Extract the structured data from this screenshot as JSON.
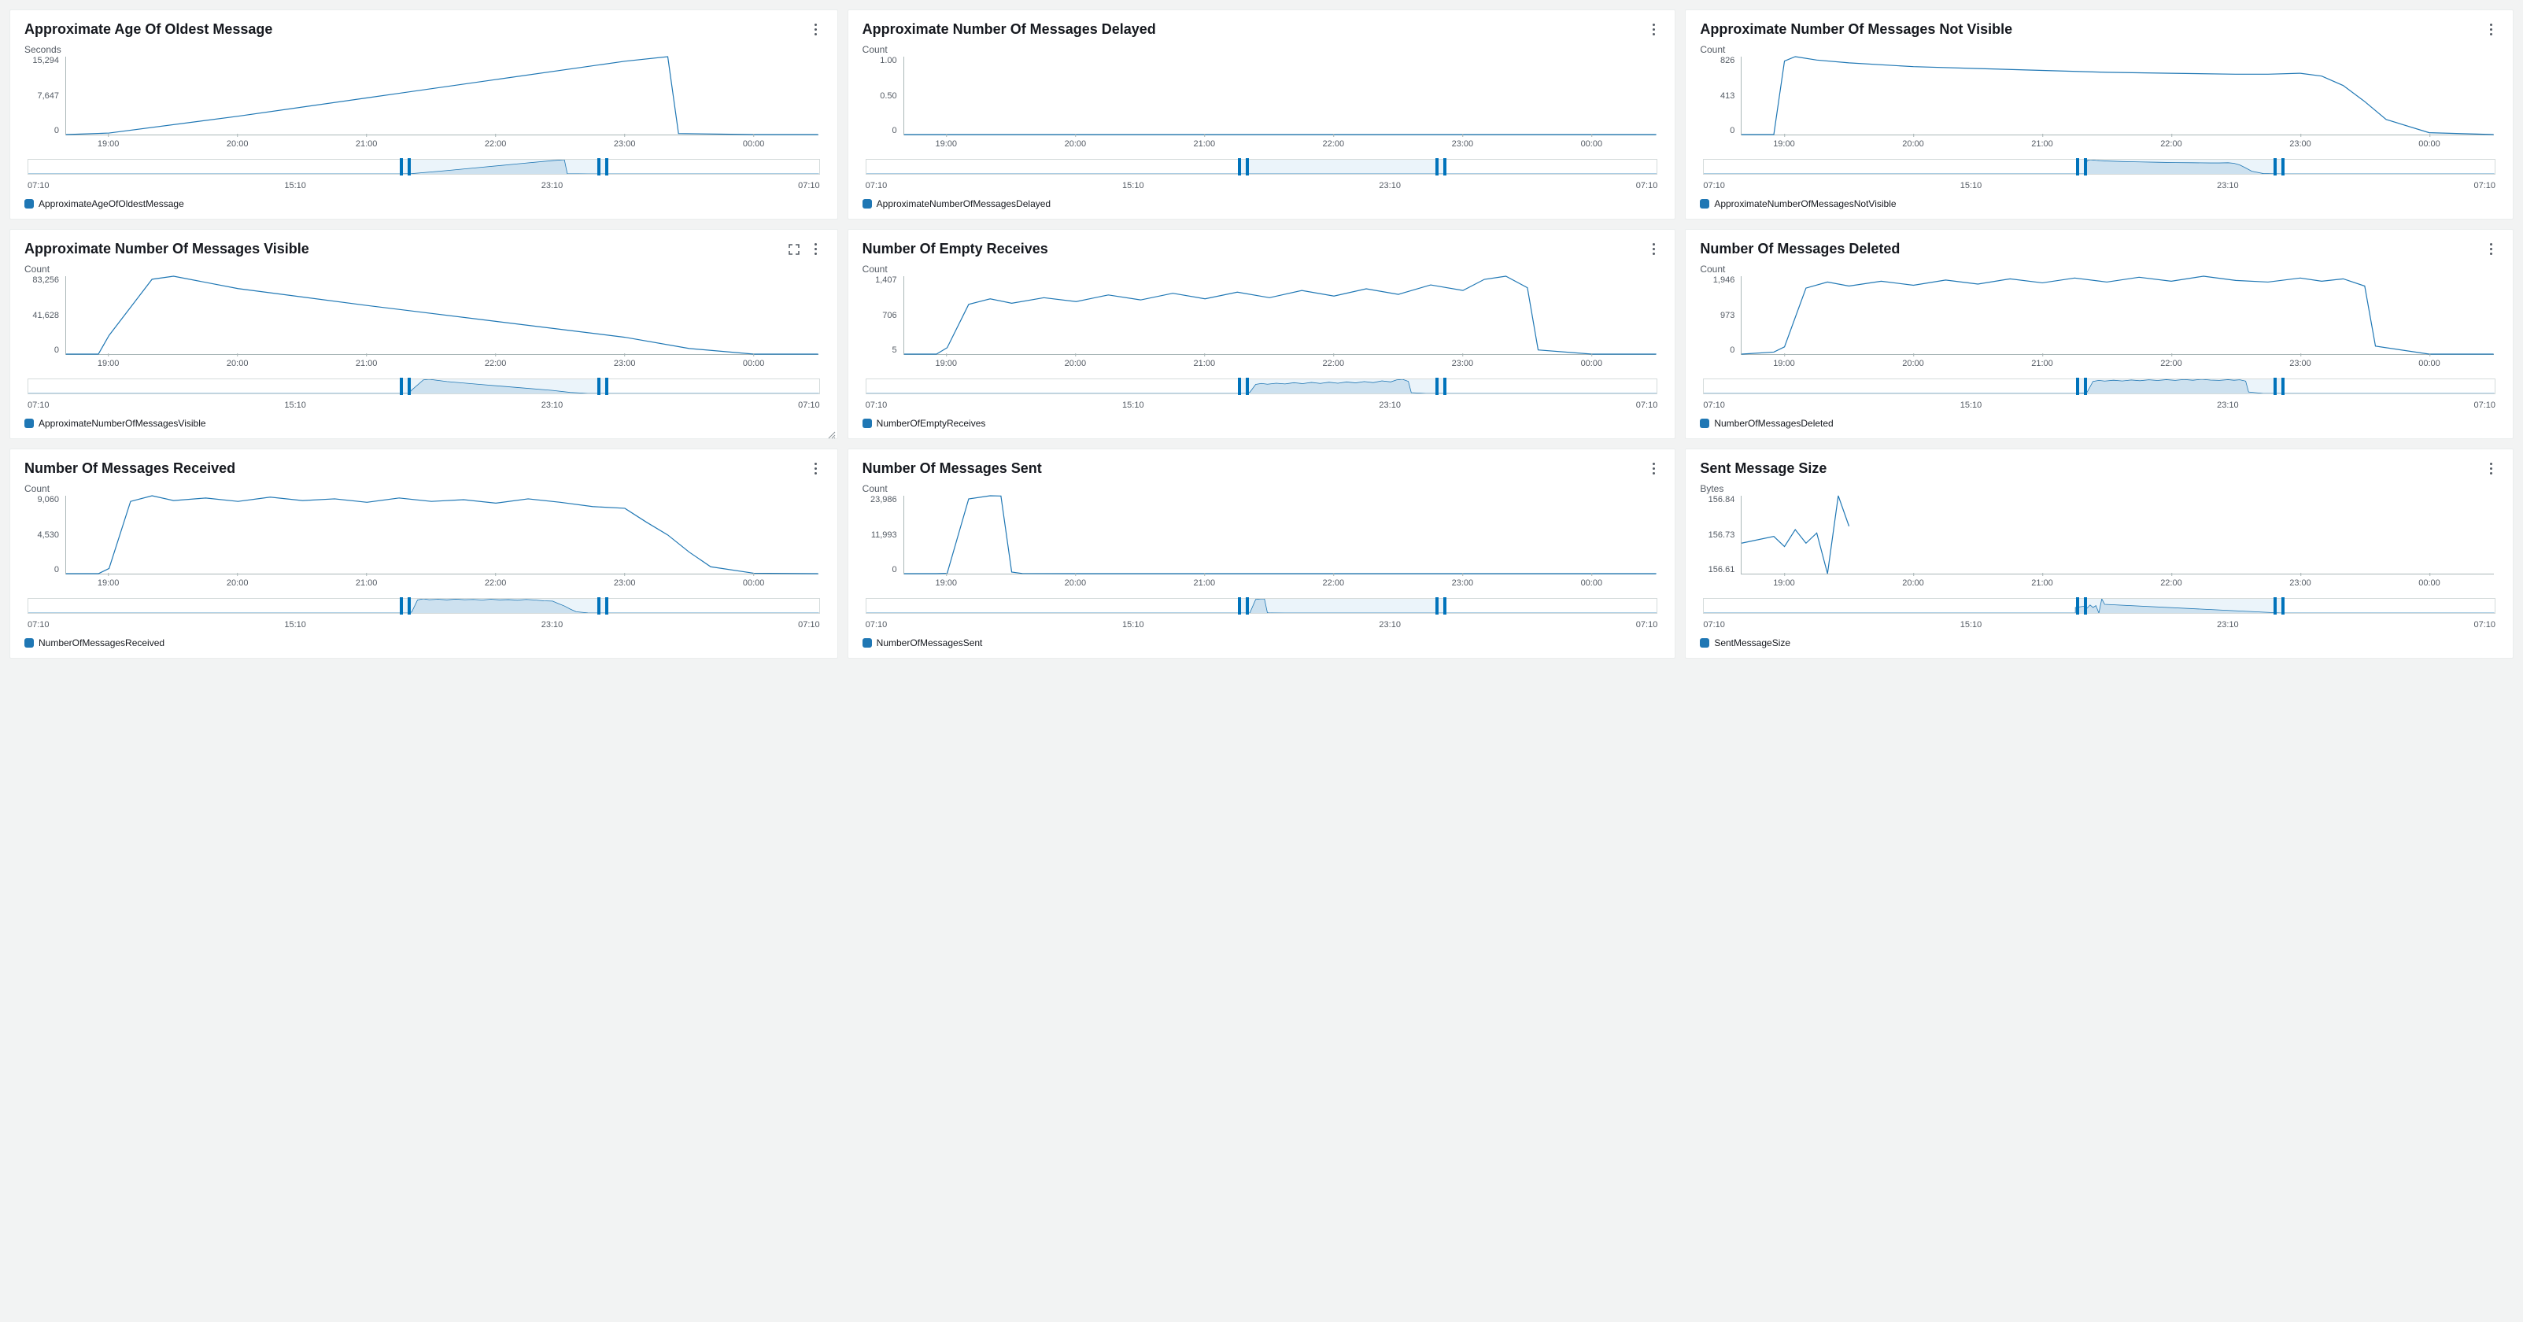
{
  "x_labels": [
    "19:00",
    "20:00",
    "21:00",
    "22:00",
    "23:00",
    "00:00"
  ],
  "overview_labels": [
    "07:10",
    "15:10",
    "23:10",
    "07:10"
  ],
  "overview_selection": {
    "start_frac": 0.47,
    "end_frac": 0.73
  },
  "overview_markers_frac": [
    0.47,
    0.48,
    0.72,
    0.73
  ],
  "cards": [
    {
      "id": "age",
      "title": "Approximate Age Of Oldest Message",
      "unit": "Seconds",
      "y_ticks": [
        "15,294",
        "7,647",
        "0"
      ],
      "legend": "ApproximateAgeOfOldestMessage",
      "expand": false,
      "resize": false
    },
    {
      "id": "delayed",
      "title": "Approximate Number Of Messages Delayed",
      "unit": "Count",
      "y_ticks": [
        "1.00",
        "0.50",
        "0"
      ],
      "legend": "ApproximateNumberOfMessagesDelayed",
      "expand": false,
      "resize": false
    },
    {
      "id": "notvisible",
      "title": "Approximate Number Of Messages Not Visible",
      "unit": "Count",
      "y_ticks": [
        "826",
        "413",
        "0"
      ],
      "legend": "ApproximateNumberOfMessagesNotVisible",
      "expand": false,
      "resize": false
    },
    {
      "id": "visible",
      "title": "Approximate Number Of Messages Visible",
      "unit": "Count",
      "y_ticks": [
        "83,256",
        "41,628",
        "0"
      ],
      "legend": "ApproximateNumberOfMessagesVisible",
      "expand": true,
      "resize": true
    },
    {
      "id": "emptyrecv",
      "title": "Number Of Empty Receives",
      "unit": "Count",
      "y_ticks": [
        "1,407",
        "706",
        "5"
      ],
      "legend": "NumberOfEmptyReceives",
      "expand": false,
      "resize": false
    },
    {
      "id": "deleted",
      "title": "Number Of Messages Deleted",
      "unit": "Count",
      "y_ticks": [
        "1,946",
        "973",
        "0"
      ],
      "legend": "NumberOfMessagesDeleted",
      "expand": false,
      "resize": false
    },
    {
      "id": "received",
      "title": "Number Of Messages Received",
      "unit": "Count",
      "y_ticks": [
        "9,060",
        "4,530",
        "0"
      ],
      "legend": "NumberOfMessagesReceived",
      "expand": false,
      "resize": false
    },
    {
      "id": "sent",
      "title": "Number Of Messages Sent",
      "unit": "Count",
      "y_ticks": [
        "23,986",
        "11,993",
        "0"
      ],
      "legend": "NumberOfMessagesSent",
      "expand": false,
      "resize": false
    },
    {
      "id": "sentsize",
      "title": "Sent Message Size",
      "unit": "Bytes",
      "y_ticks": [
        "156.84",
        "156.73",
        "156.61"
      ],
      "legend": "SentMessageSize",
      "expand": false,
      "resize": false
    }
  ],
  "chart_data": [
    {
      "id": "age",
      "type": "line",
      "title": "Approximate Age Of Oldest Message",
      "xlabel": "",
      "ylabel": "Seconds",
      "ylim": [
        0,
        15294
      ],
      "categories": [
        "18:40",
        "19:00",
        "20:00",
        "21:00",
        "22:00",
        "23:00",
        "23:20",
        "23:25",
        "00:00",
        "00:30"
      ],
      "series": [
        {
          "name": "ApproximateAgeOfOldestMessage",
          "values": [
            0,
            300,
            3600,
            7200,
            10800,
            14400,
            15294,
            200,
            0,
            0
          ]
        }
      ]
    },
    {
      "id": "delayed",
      "type": "line",
      "title": "Approximate Number Of Messages Delayed",
      "xlabel": "",
      "ylabel": "Count",
      "ylim": [
        0,
        1
      ],
      "categories": [
        "18:40",
        "19:00",
        "20:00",
        "21:00",
        "22:00",
        "23:00",
        "00:00",
        "00:30"
      ],
      "series": [
        {
          "name": "ApproximateNumberOfMessagesDelayed",
          "values": [
            0,
            0,
            0,
            0,
            0,
            0,
            0,
            0
          ]
        }
      ]
    },
    {
      "id": "notvisible",
      "type": "line",
      "title": "Approximate Number Of Messages Not Visible",
      "xlabel": "",
      "ylabel": "Count",
      "ylim": [
        0,
        826
      ],
      "categories": [
        "18:40",
        "18:55",
        "19:00",
        "19:05",
        "19:15",
        "19:30",
        "20:00",
        "20:30",
        "21:00",
        "21:30",
        "22:00",
        "22:30",
        "22:45",
        "23:00",
        "23:10",
        "23:20",
        "23:30",
        "23:40",
        "00:00",
        "00:30"
      ],
      "series": [
        {
          "name": "ApproximateNumberOfMessagesNotVisible",
          "values": [
            0,
            0,
            780,
            826,
            790,
            760,
            720,
            700,
            680,
            660,
            650,
            640,
            640,
            650,
            620,
            520,
            350,
            160,
            20,
            0
          ]
        }
      ]
    },
    {
      "id": "visible",
      "type": "line",
      "title": "Approximate Number Of Messages Visible",
      "xlabel": "",
      "ylabel": "Count",
      "ylim": [
        0,
        83256
      ],
      "categories": [
        "18:40",
        "18:55",
        "19:00",
        "19:20",
        "19:30",
        "20:00",
        "21:00",
        "22:00",
        "23:00",
        "23:30",
        "00:00",
        "00:30"
      ],
      "series": [
        {
          "name": "ApproximateNumberOfMessagesVisible",
          "values": [
            0,
            0,
            20000,
            80000,
            83256,
            70000,
            52000,
            35000,
            18000,
            6000,
            0,
            0
          ]
        }
      ]
    },
    {
      "id": "emptyrecv",
      "type": "line",
      "title": "Number Of Empty Receives",
      "xlabel": "",
      "ylabel": "Count",
      "ylim": [
        5,
        1407
      ],
      "categories": [
        "18:40",
        "18:55",
        "19:00",
        "19:10",
        "19:20",
        "19:30",
        "19:45",
        "20:00",
        "20:15",
        "20:30",
        "20:45",
        "21:00",
        "21:15",
        "21:30",
        "21:45",
        "22:00",
        "22:15",
        "22:30",
        "22:45",
        "23:00",
        "23:10",
        "23:20",
        "23:30",
        "23:35",
        "00:00",
        "00:30"
      ],
      "series": [
        {
          "name": "NumberOfEmptyReceives",
          "values": [
            5,
            5,
            120,
            900,
            1000,
            920,
            1020,
            950,
            1070,
            980,
            1100,
            1000,
            1120,
            1020,
            1150,
            1050,
            1180,
            1080,
            1250,
            1150,
            1350,
            1407,
            1200,
            80,
            5,
            5
          ]
        }
      ]
    },
    {
      "id": "deleted",
      "type": "line",
      "title": "Number Of Messages Deleted",
      "xlabel": "",
      "ylabel": "Count",
      "ylim": [
        0,
        1946
      ],
      "categories": [
        "18:40",
        "18:55",
        "19:00",
        "19:10",
        "19:20",
        "19:30",
        "19:45",
        "20:00",
        "20:15",
        "20:30",
        "20:45",
        "21:00",
        "21:15",
        "21:30",
        "21:45",
        "22:00",
        "22:15",
        "22:30",
        "22:45",
        "23:00",
        "23:10",
        "23:20",
        "23:30",
        "23:35",
        "00:00",
        "00:30"
      ],
      "series": [
        {
          "name": "NumberOfMessagesDeleted",
          "values": [
            0,
            50,
            180,
            1650,
            1800,
            1700,
            1820,
            1720,
            1850,
            1750,
            1880,
            1780,
            1900,
            1800,
            1920,
            1820,
            1946,
            1840,
            1800,
            1900,
            1820,
            1880,
            1700,
            200,
            0,
            0
          ]
        }
      ]
    },
    {
      "id": "received",
      "type": "line",
      "title": "Number Of Messages Received",
      "xlabel": "",
      "ylabel": "Count",
      "ylim": [
        0,
        9060
      ],
      "categories": [
        "18:40",
        "18:55",
        "19:00",
        "19:10",
        "19:20",
        "19:30",
        "19:45",
        "20:00",
        "20:15",
        "20:30",
        "20:45",
        "21:00",
        "21:15",
        "21:30",
        "21:45",
        "22:00",
        "22:15",
        "22:30",
        "22:45",
        "23:00",
        "23:10",
        "23:20",
        "23:30",
        "23:40",
        "00:00",
        "00:30"
      ],
      "series": [
        {
          "name": "NumberOfMessagesReceived",
          "values": [
            0,
            0,
            600,
            8400,
            9060,
            8500,
            8800,
            8400,
            8900,
            8500,
            8700,
            8300,
            8800,
            8400,
            8600,
            8200,
            8700,
            8300,
            7800,
            7600,
            6000,
            4500,
            2500,
            800,
            50,
            0
          ]
        }
      ]
    },
    {
      "id": "sent",
      "type": "line",
      "title": "Number Of Messages Sent",
      "xlabel": "",
      "ylabel": "Count",
      "ylim": [
        0,
        23986
      ],
      "categories": [
        "18:40",
        "18:55",
        "19:00",
        "19:10",
        "19:20",
        "19:25",
        "19:30",
        "19:35",
        "20:00",
        "21:00",
        "22:00",
        "23:00",
        "00:00",
        "00:30"
      ],
      "series": [
        {
          "name": "NumberOfMessagesSent",
          "values": [
            0,
            0,
            100,
            23000,
            23986,
            23900,
            500,
            50,
            0,
            0,
            0,
            0,
            0,
            0
          ]
        }
      ]
    },
    {
      "id": "sentsize",
      "type": "line",
      "title": "Sent Message Size",
      "xlabel": "",
      "ylabel": "Bytes",
      "ylim": [
        156.61,
        156.84
      ],
      "categories": [
        "18:40",
        "18:55",
        "19:00",
        "19:05",
        "19:10",
        "19:15",
        "19:20",
        "19:25",
        "19:30"
      ],
      "series": [
        {
          "name": "SentMessageSize",
          "values": [
            156.7,
            156.72,
            156.69,
            156.74,
            156.7,
            156.73,
            156.61,
            156.84,
            156.75
          ]
        }
      ],
      "note": "series ends at 19:30; no baseline after"
    }
  ]
}
